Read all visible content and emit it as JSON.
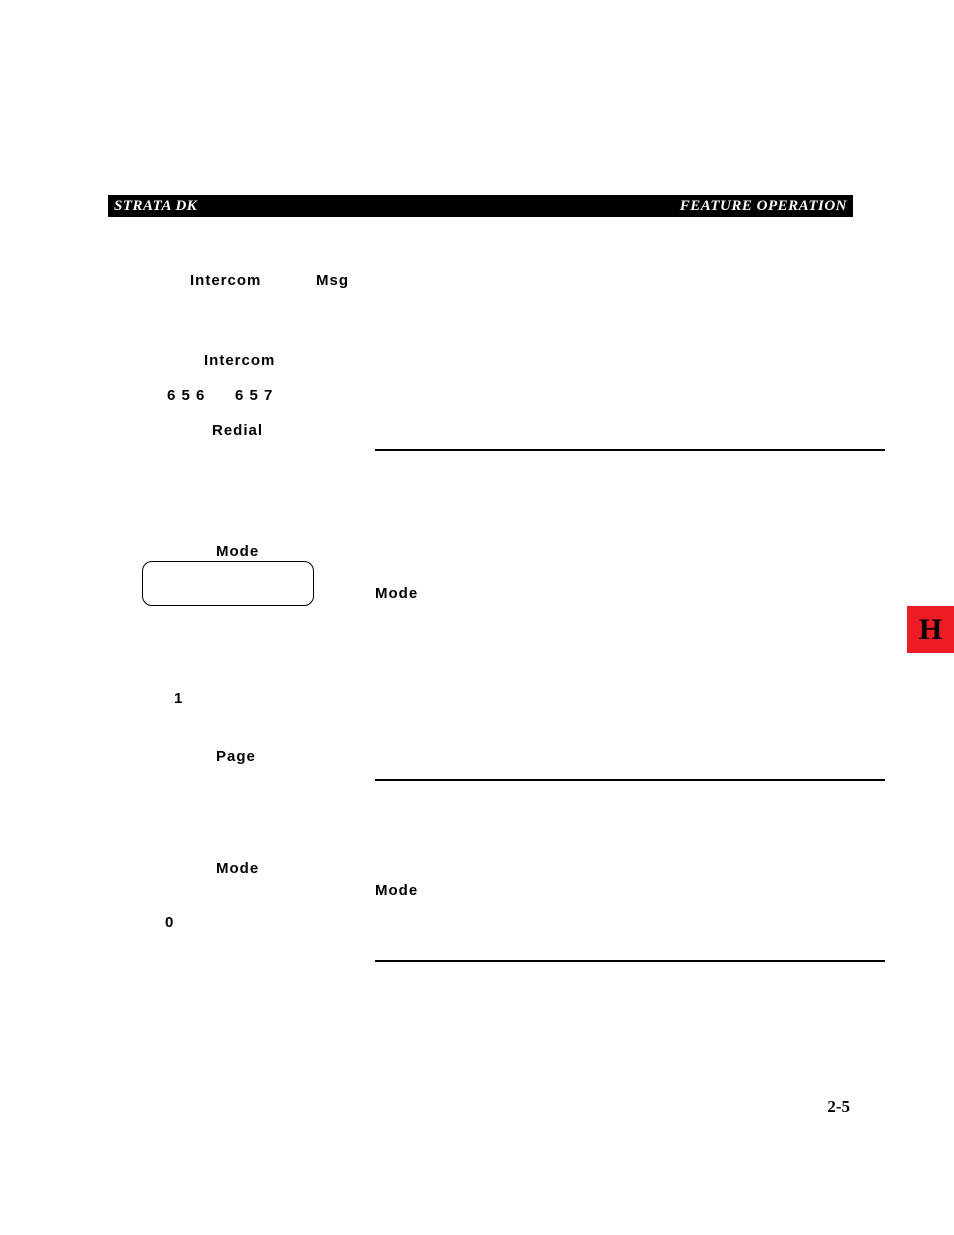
{
  "header": {
    "left": "STRATA DK",
    "right": "FEATURE OPERATION"
  },
  "side_tab": "H",
  "page_number": "2-5",
  "words": {
    "intercom1": "Intercom",
    "msg": "Msg",
    "intercom2": "Intercom",
    "digits1": "6 5 6",
    "digits2": "6 5 7",
    "redial": "Redial",
    "mode1": "Mode",
    "mode2": "Mode",
    "one": "1",
    "page": "Page",
    "mode3": "Mode",
    "mode4": "Mode",
    "zero": "0"
  }
}
